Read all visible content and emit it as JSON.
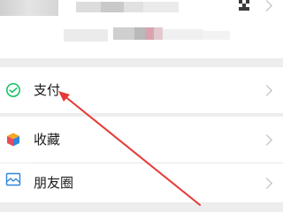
{
  "menu": {
    "pay": {
      "label": "支付",
      "icon": "wechat-pay-icon"
    },
    "favorites": {
      "label": "收藏",
      "icon": "favorites-cube-icon"
    },
    "moments": {
      "label": "朋友圈",
      "icon": "moments-image-icon"
    }
  },
  "colors": {
    "pay_green": "#07c160",
    "annotation_red": "#e53935",
    "background": "#ededed"
  }
}
